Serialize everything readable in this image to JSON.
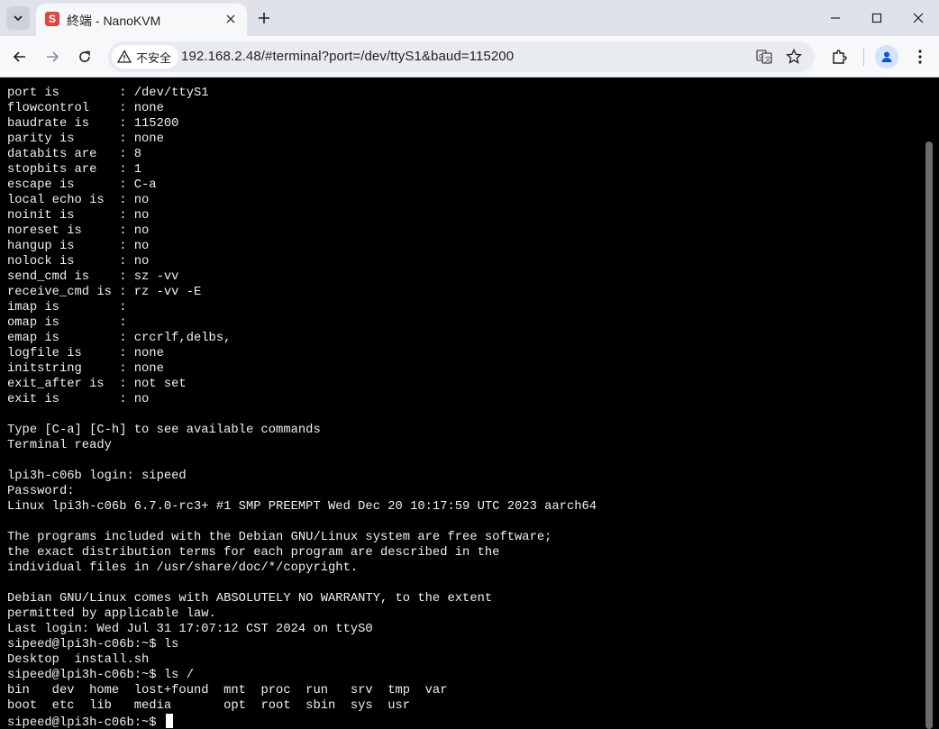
{
  "browser": {
    "tab": {
      "favicon_letter": "S",
      "title": "終端 - NanoKVM",
      "favicon_color": "#e0463b"
    },
    "security_label": "不安全",
    "url": "192.168.2.48/#terminal?port=/dev/ttyS1&baud=115200"
  },
  "terminal": {
    "lines": [
      "port is        : /dev/ttyS1",
      "flowcontrol    : none",
      "baudrate is    : 115200",
      "parity is      : none",
      "databits are   : 8",
      "stopbits are   : 1",
      "escape is      : C-a",
      "local echo is  : no",
      "noinit is      : no",
      "noreset is     : no",
      "hangup is      : no",
      "nolock is      : no",
      "send_cmd is    : sz -vv",
      "receive_cmd is : rz -vv -E",
      "imap is        :",
      "omap is        :",
      "emap is        : crcrlf,delbs,",
      "logfile is     : none",
      "initstring     : none",
      "exit_after is  : not set",
      "exit is        : no",
      "",
      "Type [C-a] [C-h] to see available commands",
      "Terminal ready",
      "",
      "lpi3h-c06b login: sipeed",
      "Password:",
      "Linux lpi3h-c06b 6.7.0-rc3+ #1 SMP PREEMPT Wed Dec 20 10:17:59 UTC 2023 aarch64",
      "",
      "The programs included with the Debian GNU/Linux system are free software;",
      "the exact distribution terms for each program are described in the",
      "individual files in /usr/share/doc/*/copyright.",
      "",
      "Debian GNU/Linux comes with ABSOLUTELY NO WARRANTY, to the extent",
      "permitted by applicable law.",
      "Last login: Wed Jul 31 17:07:12 CST 2024 on ttyS0",
      "sipeed@lpi3h-c06b:~$ ls",
      "Desktop  install.sh",
      "sipeed@lpi3h-c06b:~$ ls /",
      "bin   dev  home  lost+found  mnt  proc  run   srv  tmp  var",
      "boot  etc  lib   media       opt  root  sbin  sys  usr"
    ],
    "prompt": "sipeed@lpi3h-c06b:~$ "
  }
}
